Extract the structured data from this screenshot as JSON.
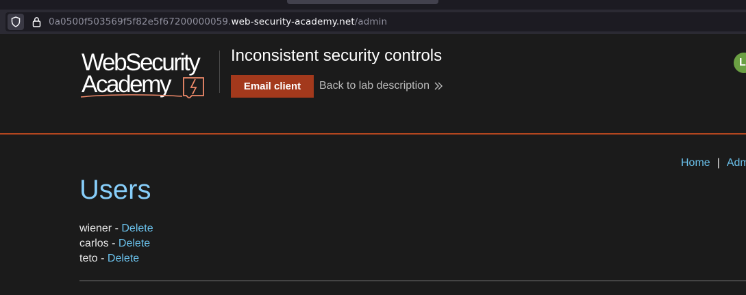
{
  "browser": {
    "url_prefix": "0a0500f503569f5f82e5f67200000059.",
    "url_host": "web-security-academy.net",
    "url_path": "/admin"
  },
  "header": {
    "logo_line1": "WebSecurity",
    "logo_line2": "Academy",
    "lab_title": "Inconsistent security controls",
    "email_button": "Email client",
    "back_link": "Back to lab description",
    "avatar_letter": "L"
  },
  "nav": {
    "home": "Home",
    "separator": "|",
    "admin": "Adm"
  },
  "main": {
    "title": "Users",
    "users": [
      {
        "name": "wiener",
        "sep": " - ",
        "action": "Delete"
      },
      {
        "name": "carlos",
        "sep": " - ",
        "action": "Delete"
      },
      {
        "name": "teto",
        "sep": " - ",
        "action": "Delete"
      }
    ]
  },
  "colors": {
    "accent": "#a3391c",
    "link": "#6ac0ea",
    "title": "#87cefa",
    "background": "#1b1b1b"
  }
}
